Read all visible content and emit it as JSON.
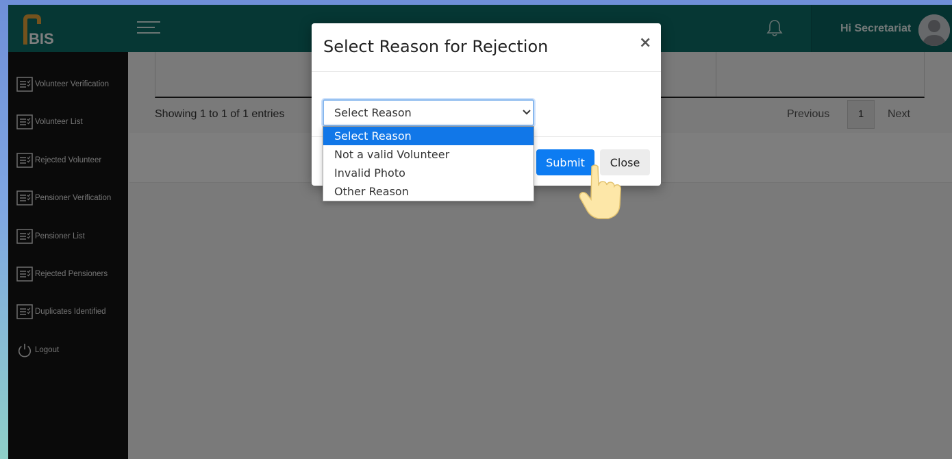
{
  "app": {
    "logo_text": "BIS",
    "user_greeting": "Hi Secretariat"
  },
  "sidebar": {
    "items": [
      {
        "label": "Volunteer Verification",
        "icon": "list-icon"
      },
      {
        "label": "Volunteer List",
        "icon": "list-icon"
      },
      {
        "label": "Rejected Volunteer",
        "icon": "list-icon"
      },
      {
        "label": "Pensioner Verification",
        "icon": "list-icon"
      },
      {
        "label": "Pensioner List",
        "icon": "list-icon"
      },
      {
        "label": "Rejected Pensioners",
        "icon": "list-icon"
      },
      {
        "label": "Duplicates Identified",
        "icon": "list-icon"
      },
      {
        "label": "Logout",
        "icon": "power-icon"
      }
    ]
  },
  "main": {
    "showing_text": "Showing 1 to 1 of 1 entries",
    "pagination": {
      "previous": "Previous",
      "page": "1",
      "next": "Next"
    }
  },
  "modal": {
    "title": "Select Reason for Rejection",
    "close_symbol": "×",
    "select_value": "Select Reason",
    "options": [
      "Select Reason",
      "Not a valid Volunteer",
      "Invalid Photo",
      "Other Reason"
    ],
    "selected_index": 0,
    "submit_label": "Submit",
    "close_label": "Close"
  },
  "colors": {
    "header": "#0d6e69",
    "sidebar": "#141414",
    "primary": "#0d7cf2",
    "logo_orange": "#e8a43a"
  }
}
